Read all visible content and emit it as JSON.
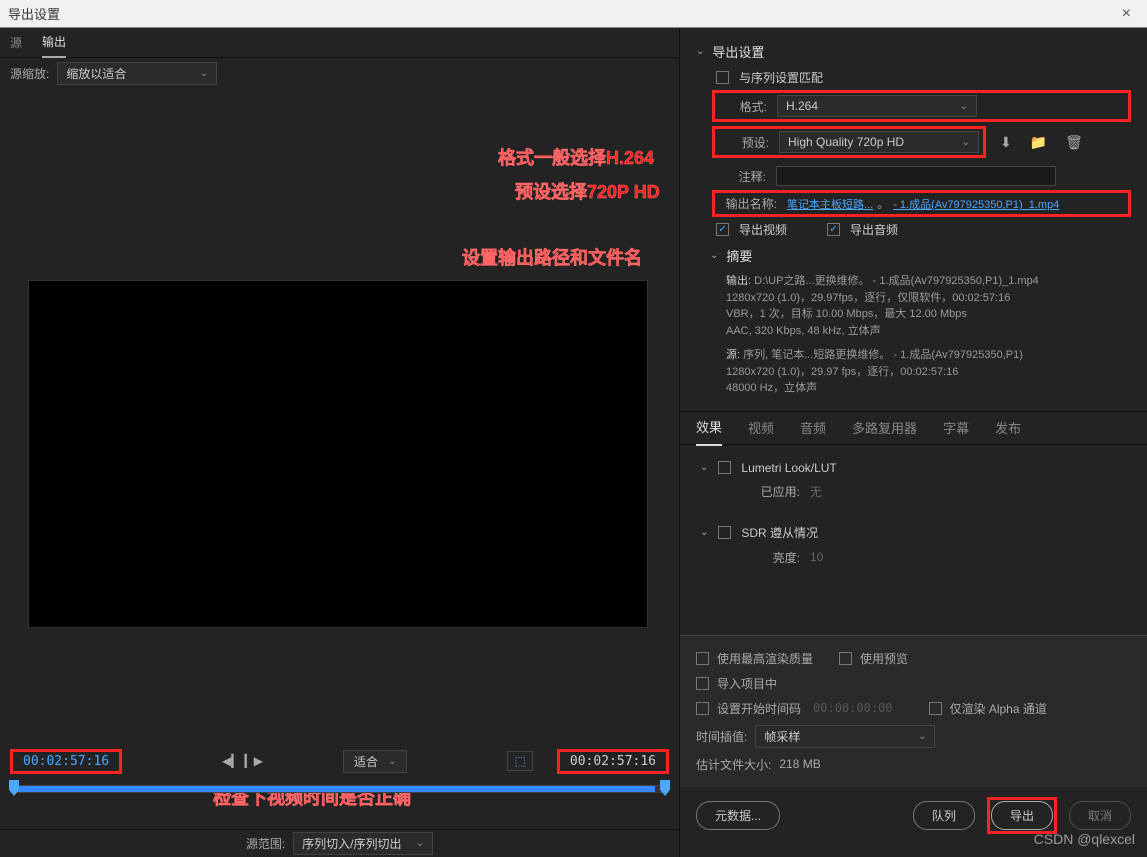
{
  "window": {
    "title": "导出设置",
    "close": "×"
  },
  "sourceTabs": {
    "source": "源",
    "output": "输出"
  },
  "scale": {
    "label": "源缩放:",
    "value": "缩放以适合"
  },
  "annotations": {
    "format": "格式一般选择H.264",
    "preset": "预设选择720P HD",
    "outputPath": "设置输出路径和文件名",
    "checkTime": "检查下视频时间是否正确"
  },
  "timecode": {
    "left": "00:02:57:16",
    "right": "00:02:57:16",
    "fit": "适合"
  },
  "sourceRange": {
    "label": "源范围:",
    "value": "序列切入/序列切出"
  },
  "export": {
    "title": "导出设置",
    "matchSequence": "与序列设置匹配",
    "formatLabel": "格式:",
    "formatValue": "H.264",
    "presetLabel": "预设:",
    "presetValue": "High Quality 720p HD",
    "commentLabel": "注释:",
    "outputNameLabel": "输出名称:",
    "outputNameLink1": "笔记本主板短路...",
    "outputNameSep": "。",
    "outputNameLink2": "- 1.成品(Av797925350,P1)_1.mp4",
    "exportVideo": "导出视频",
    "exportAudio": "导出音频"
  },
  "summary": {
    "title": "摘要",
    "outputLabel": "输出:",
    "outputLine1": "D:\\UP之路...更换维修。 - 1.成品(Av797925350,P1)_1.mp4",
    "outputLine2": "1280x720 (1.0)，29.97fps，逐行，仅限软件，00:02:57:16",
    "outputLine3": "VBR，1 次，目标 10.00 Mbps，最大 12.00 Mbps",
    "outputLine4": "AAC, 320 Kbps, 48  kHz, 立体声",
    "sourceLabel": "源:",
    "sourceLine1": "序列, 笔记本...短路更换维修。 - 1.成品(Av797925350,P1)",
    "sourceLine2": "1280x720 (1.0)，29.97 fps，逐行，00:02:57:16",
    "sourceLine3": "48000 Hz，立体声"
  },
  "tabs": {
    "effects": "效果",
    "video": "视频",
    "audio": "音频",
    "mux": "多路复用器",
    "captions": "字幕",
    "publish": "发布"
  },
  "effects": {
    "lumetri": "Lumetri Look/LUT",
    "appliedLabel": "已应用:",
    "appliedValue": "无",
    "sdr": "SDR 遵从情况",
    "brightnessLabel": "亮度:",
    "brightnessValue": "10"
  },
  "bottomOpts": {
    "maxRender": "使用最高渲染质量",
    "usePreview": "使用预览",
    "importProject": "导入项目中",
    "setStartTC": "设置开始时间码",
    "startTC": "00:00:00:00",
    "renderAlpha": "仅渲染 Alpha 通道",
    "timeInterpLabel": "时间插值:",
    "timeInterpValue": "帧采样",
    "estSizeLabel": "估计文件大小:",
    "estSizeValue": "218 MB"
  },
  "buttons": {
    "metadata": "元数据...",
    "queue": "队列",
    "export": "导出",
    "cancel": "取消"
  },
  "watermark": "CSDN @qlexcel"
}
